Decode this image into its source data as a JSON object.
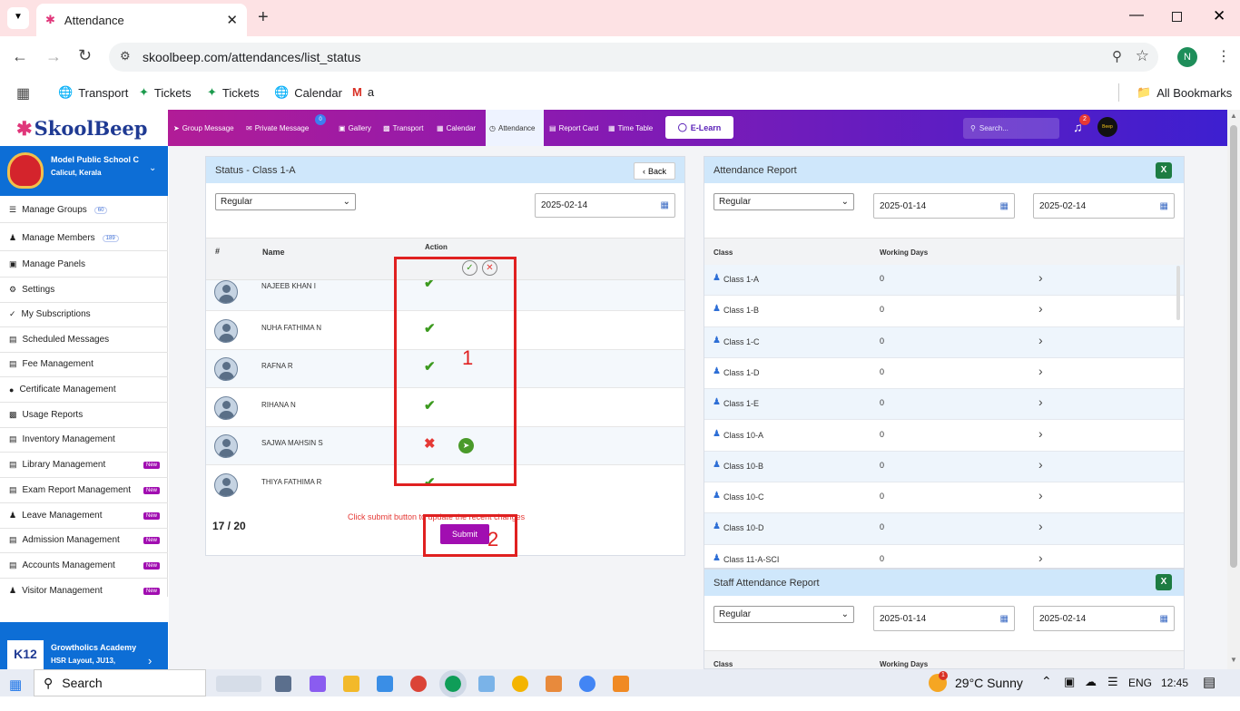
{
  "browser": {
    "tab_title": "Attendance",
    "url": "skoolbeep.com/attendances/list_status",
    "profile_initial": "N",
    "bookmarks": [
      "Transport",
      "Tickets",
      "Tickets",
      "Calendar",
      "a"
    ],
    "all_bookmarks": "All Bookmarks"
  },
  "app": {
    "logo": "SkoolBeep",
    "nav": [
      "Group Message",
      "Private Message",
      "Gallery",
      "Transport",
      "Calendar",
      "Attendance",
      "Report Card",
      "Time Table"
    ],
    "private_badge": "0",
    "elearn": "E-Learn",
    "search_placeholder": "Search...",
    "notif_count": "2",
    "avatar_text": "Beep"
  },
  "school": {
    "name": "Model Public School C",
    "location": "Calicut, Kerala"
  },
  "sidebar": {
    "items": [
      {
        "label": "Manage Groups",
        "count": "60"
      },
      {
        "label": "Manage Members",
        "count": "189"
      },
      {
        "label": "Manage Panels"
      },
      {
        "label": "Settings"
      },
      {
        "label": "My Subscriptions"
      },
      {
        "label": "Scheduled Messages"
      },
      {
        "label": "Fee Management"
      },
      {
        "label": "Certificate Management"
      },
      {
        "label": "Usage Reports"
      },
      {
        "label": "Inventory Management"
      },
      {
        "label": "Library Management",
        "badge": "New"
      },
      {
        "label": "Exam Report Management",
        "badge": "New"
      },
      {
        "label": "Leave Management",
        "badge": "New"
      },
      {
        "label": "Admission Management",
        "badge": "New"
      },
      {
        "label": "Accounts Management",
        "badge": "New"
      },
      {
        "label": "Visitor Management",
        "badge": "New"
      }
    ],
    "other_school": {
      "name": "Growtholics Academy",
      "location": "HSR Layout, JU13,",
      "logo": "K12"
    }
  },
  "status_panel": {
    "title": "Status - Class 1-A",
    "back": "Back",
    "type": "Regular",
    "date": "2025-02-14",
    "col_hash": "#",
    "col_name": "Name",
    "col_action": "Action",
    "students": [
      {
        "name": "NAJEEB KHAN I",
        "status": "present"
      },
      {
        "name": "NUHA FATHIMA N",
        "status": "present"
      },
      {
        "name": "RAFNA R",
        "status": "present"
      },
      {
        "name": "RIHANA N",
        "status": "present"
      },
      {
        "name": "SAJWA MAHSIN S",
        "status": "absent"
      },
      {
        "name": "THIYA FATHIMA R",
        "status": "present"
      }
    ],
    "count": "17 / 20",
    "hint": "Click submit button to update the recent changes",
    "submit": "Submit",
    "annot1": "1",
    "annot2": "2"
  },
  "attendance_report": {
    "title": "Attendance Report",
    "type": "Regular",
    "from": "2025-01-14",
    "to": "2025-02-14",
    "col_class": "Class",
    "col_days": "Working Days",
    "rows": [
      {
        "class": "Class 1-A",
        "days": "0"
      },
      {
        "class": "Class 1-B",
        "days": "0"
      },
      {
        "class": "Class 1-C",
        "days": "0"
      },
      {
        "class": "Class 1-D",
        "days": "0"
      },
      {
        "class": "Class 1-E",
        "days": "0"
      },
      {
        "class": "Class 10-A",
        "days": "0"
      },
      {
        "class": "Class 10-B",
        "days": "0"
      },
      {
        "class": "Class 10-C",
        "days": "0"
      },
      {
        "class": "Class 10-D",
        "days": "0"
      },
      {
        "class": "Class 11-A-SCI",
        "days": "0"
      }
    ]
  },
  "staff_report": {
    "title": "Staff Attendance Report",
    "type": "Regular",
    "from": "2025-01-14",
    "to": "2025-02-14",
    "col_class": "Class",
    "col_days": "Working Days"
  },
  "taskbar": {
    "search": "Search",
    "weather": "29°C  Sunny",
    "weather_badge": "1",
    "lang": "ENG",
    "time": "12:45"
  },
  "colors": {
    "header_start": "#c21d8c",
    "header_end": "#3d1fd0",
    "present": "#3c9a1f",
    "absent": "#e53935",
    "annotation": "#e02020"
  }
}
